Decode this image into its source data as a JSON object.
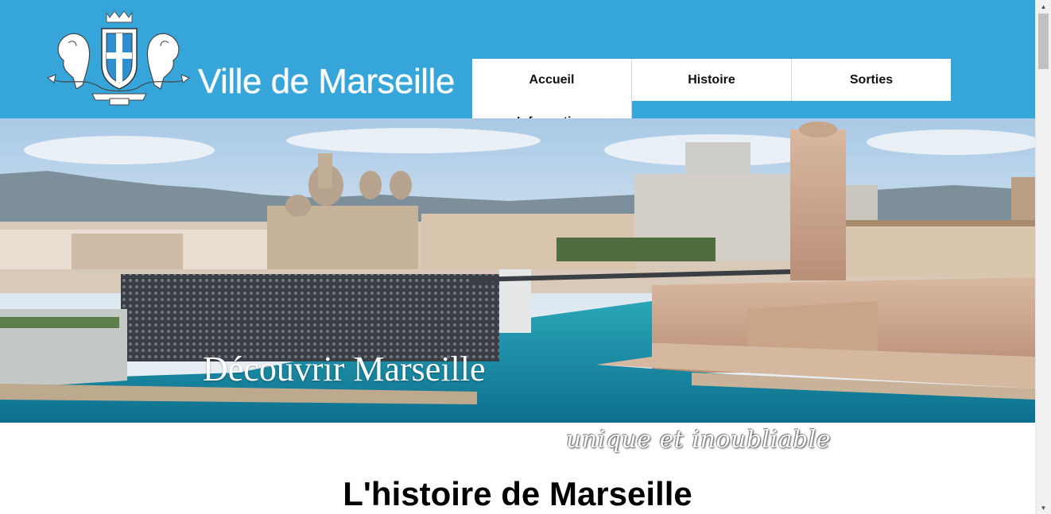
{
  "site": {
    "title": "Ville de Marseille",
    "logo": "marseille-coat-of-arms",
    "header_color": "#35a5da"
  },
  "nav": {
    "items": [
      {
        "label": "Accueil"
      },
      {
        "label": "Histoire"
      },
      {
        "label": "Sorties"
      },
      {
        "label": "Information"
      }
    ]
  },
  "hero": {
    "caption": "Découvrir Marseille",
    "image": "marseille-old-port-panorama"
  },
  "content": {
    "tagline": "unique et inoubliable",
    "section_title": "L'histoire de Marseille"
  },
  "scrollbar": {
    "up_icon": "scroll-up-arrow",
    "down_icon": "scroll-down-arrow"
  }
}
